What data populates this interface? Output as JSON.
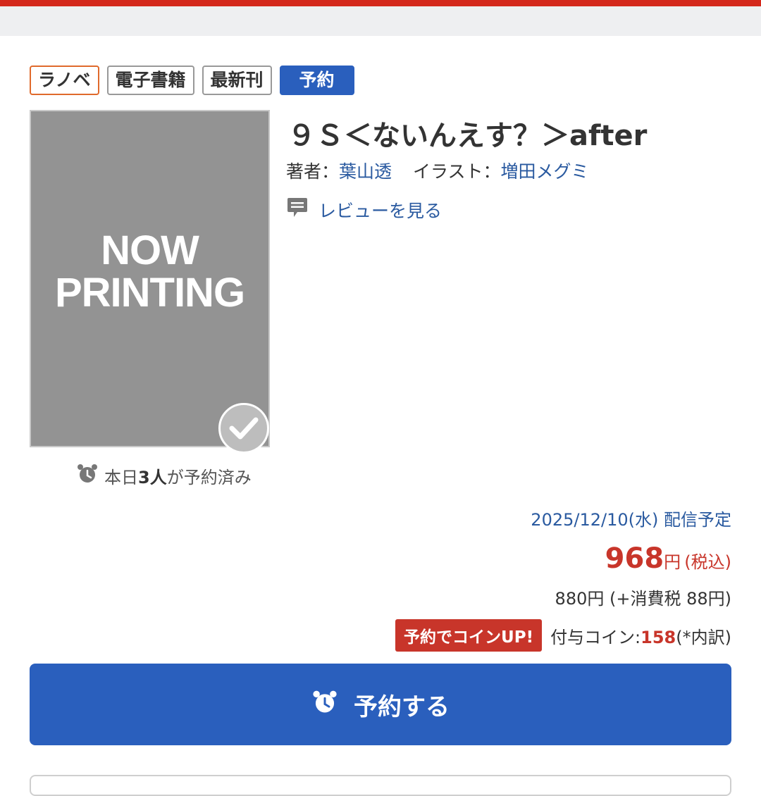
{
  "tags": [
    {
      "label": "ラノベ"
    },
    {
      "label": "電子書籍"
    },
    {
      "label": "最新刊"
    },
    {
      "label": "予約"
    }
  ],
  "cover": {
    "line1": "NOW",
    "line2": "PRINTING"
  },
  "reserved_info": {
    "prefix": "本日",
    "count": "3人",
    "suffix": "が予約済み"
  },
  "book": {
    "title": "９Ｓ＜ないんえす？＞after",
    "author_label": "著者：",
    "author": "葉山透",
    "illust_label": "イラスト：",
    "illustrator": "増田メグミ"
  },
  "review_link": "レビューを見る",
  "release": {
    "date": "2025/12/10(水)",
    "label": "配信予定"
  },
  "price": {
    "amount": "968",
    "unit": "円",
    "tax_note": "(税込)",
    "breakdown": "880円 (+消費税 88円)"
  },
  "coin": {
    "badge": "予約でコインUP!",
    "label": "付与コイン:",
    "amount": "158",
    "note": "(*内訳)"
  },
  "reserve_button": {
    "label": "予約する"
  },
  "colors": {
    "primary": "#2a5fbd",
    "accent_red": "#c8352a",
    "header_red": "#d4281c"
  }
}
